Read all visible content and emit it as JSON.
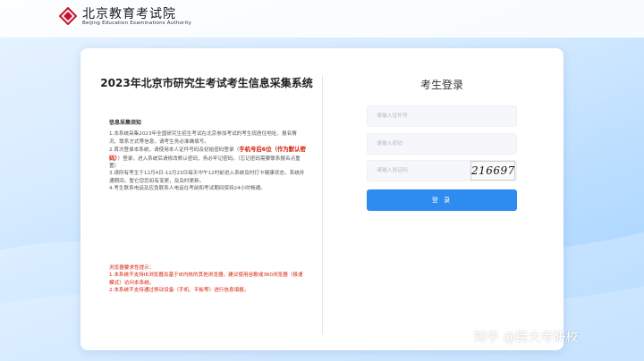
{
  "header": {
    "org_name_cn": "北京教育考试院",
    "org_name_en": "Beijing Education Examinations Authority"
  },
  "left": {
    "title": "2023年北京市研究生考试考生信息采集系统",
    "notice_heading": "信息采集须知",
    "notice_items": [
      "1.本系统采集2023年全国研究生招生考试在北京参加考试的考生现居住地址、报名情况、联系方式等信息，请考生务必准确填写。",
      "2.首次登录本系统，请使用本人证件号码及初始密码登录（",
      "手机号后6位（作为默认密码）",
      "）登录，进入系统后请修改默认密码，务必牢记密码。（忘记密码需要联系报名点重置）",
      "3.请所有考生于12月4日-12月23日每天中午12时前进入系统及时打卡健康状态，系统并通期间，暂它您您如有变更，及及时更新。",
      "4.考生联系电话及应急联系人电话在考前和考试期间保持24小时畅通。"
    ],
    "browser_heading": "浏览器要求性提示：",
    "browser_items": [
      "1.本系统不支持IE浏览器及基于IE内核的其他浏览器，建议使用谷歌或360浏览器（极速模式）访问本系统。",
      "2.本系统不支持通过移动设备（手机、平板等）进行信息填报。"
    ]
  },
  "login": {
    "title": "考生登录",
    "id_placeholder": "请输入证件号",
    "password_placeholder": "请输入密码",
    "captcha_placeholder": "请输入验证码",
    "captcha_text": "216697",
    "button_label": "登 录"
  },
  "watermark": "知乎 @民大考研校",
  "colors": {
    "accent": "#2e8bf0",
    "highlight": "#d81e06",
    "logo_red": "#c8102e"
  }
}
